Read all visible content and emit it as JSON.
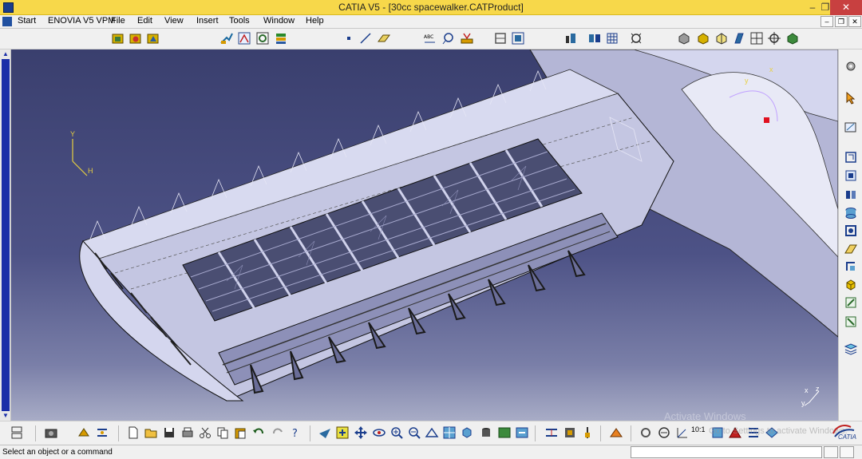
{
  "window": {
    "title": "CATIA V5 - [30cc spacewalker.CATProduct]",
    "min_glyph": "–",
    "max_glyph": "❐",
    "close_glyph": "✕"
  },
  "menu": {
    "items": [
      "Start",
      "ENOVIA V5 VPM",
      "File",
      "Edit",
      "View",
      "Insert",
      "Tools",
      "Window",
      "Help"
    ],
    "mdi_min": "–",
    "mdi_restore": "❐",
    "mdi_close": "✕"
  },
  "viewport": {
    "compass_labels": [
      "y",
      "x"
    ],
    "axis_labels": {
      "left_y": "Y",
      "left_h": "H",
      "br_x": "x",
      "br_z": "z",
      "br_y": "y"
    },
    "watermark_title": "Activate Windows",
    "watermark_sub": "Go to Settings to activate Windows."
  },
  "status": {
    "message": "Select an object or a command",
    "command_value": ""
  },
  "toolbar_bottom": {
    "zoom_label": "10:1"
  },
  "brand": {
    "logo_text": "CATIA",
    "accent": "#1a2ea8",
    "title_bar": "#f7d84a"
  }
}
